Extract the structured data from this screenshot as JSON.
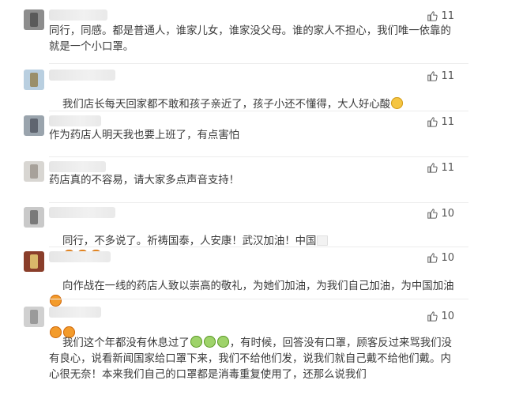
{
  "comments": [
    {
      "likes": "11",
      "text": "同行，同感。都是普通人，谁家儿女，谁家没父母。谁的家人不担心，我们唯一依靠的就是一个小口罩。",
      "avatar_colors": [
        "#8d8d8d",
        "#5a5a5a"
      ]
    },
    {
      "likes": "11",
      "text": "我们店长每天回家都不敢和孩子亲近了，孩子小还不懂得，大人好心酸",
      "emojis": [
        "sad-face-icon"
      ],
      "avatar_colors": [
        "#b9cfe0",
        "#9a8f6a"
      ]
    },
    {
      "likes": "11",
      "text": "作为药店人明天我也要上班了，有点害怕",
      "avatar_colors": [
        "#9aa4ad",
        "#5f6570"
      ]
    },
    {
      "likes": "11",
      "text": "药店真的不容易，请大家多点声音支持！",
      "avatar_colors": [
        "#d8d6d2",
        "#a7a19a"
      ]
    },
    {
      "likes": "10",
      "text": "同行，不多说了。祈祷国泰，人安康！武汉加油！中国",
      "emojis": [
        "china-flag-icon",
        "fist-icon",
        "fist-icon",
        "fist-icon"
      ],
      "avatar_colors": [
        "#c9c9c9",
        "#7a7a7a"
      ]
    },
    {
      "likes": "10",
      "text": "向作战在一线的药店人致以崇高的敬礼，为她们加油，为我们自己加油，为中国加油",
      "emojis_trailing": [
        "fist-icon"
      ],
      "emojis_next_line": [
        "fist-icon",
        "fist-icon"
      ],
      "avatar_colors": [
        "#8a3e2a",
        "#d9b86a"
      ]
    },
    {
      "likes": "10",
      "text_part1": "我们这个年都没有休息过了",
      "text_part2": "，有时候，回答没有口罩，顾客反过来骂我们没有良心，说看新闻国家给口罩下来，我们不给他们发，说我们就自己戴不给他们戴。内心很无奈！本来我们自己的口罩都是消毒重复使用了，还那么说我们",
      "emojis": [
        "crying-face-icon",
        "crying-face-icon",
        "crying-face-icon"
      ],
      "avatar_colors": [
        "#d0d0d0",
        "#9a9a9a"
      ]
    }
  ],
  "icons": {
    "like": "thumbs-up-icon"
  },
  "colors": {
    "text": "#3a3a3a",
    "like": "#555555",
    "divider": "#ececec"
  }
}
